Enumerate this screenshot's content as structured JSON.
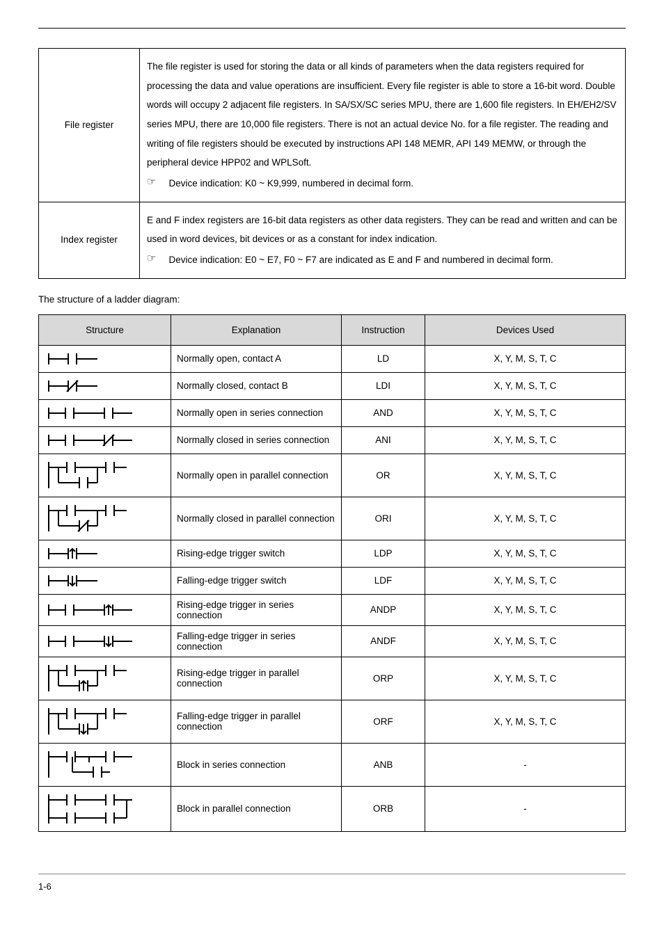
{
  "register_rows": [
    {
      "label": "File register",
      "paragraphs": [
        "The file register is used for storing the data or all kinds of parameters when the data registers required for processing the data and value operations are insufficient. Every file register is able to store a 16-bit word. Double words will occupy 2 adjacent file registers. In SA/SX/SC series MPU, there are 1,600 file registers. In EH/EH2/SV series MPU, there are 10,000 file registers. There is not an actual device No. for a file register. The reading and writing of file registers should be executed by instructions API 148 MEMR, API 149 MEMW, or through the peripheral device HPP02 and WPLSoft."
      ],
      "bullets": [
        "Device indication: K0 ~ K9,999, numbered in decimal form."
      ]
    },
    {
      "label": "Index register",
      "paragraphs": [
        "E and F index registers are 16-bit data registers as other data registers. They can be read and written and can be used in word devices, bit devices or as a constant for index indication."
      ],
      "bullets": [
        "Device indication: E0 ~ E7, F0 ~ F7 are indicated as E and F and numbered in decimal form."
      ]
    }
  ],
  "structure_caption": "The structure of a ladder diagram:",
  "structure_headers": {
    "structure": "Structure",
    "explanation": "Explanation",
    "instruction": "Instruction",
    "devices": "Devices Used"
  },
  "structure_rows": [
    {
      "icon": "no_a",
      "explanation": "Normally open, contact A",
      "instruction": "LD",
      "devices": "X, Y, M, S, T, C",
      "tall": false
    },
    {
      "icon": "nc_b",
      "explanation": "Normally closed, contact B",
      "instruction": "LDI",
      "devices": "X, Y, M, S, T, C",
      "tall": false
    },
    {
      "icon": "no_series",
      "explanation": "Normally open in series connection",
      "instruction": "AND",
      "devices": "X, Y, M, S, T, C",
      "tall": false
    },
    {
      "icon": "nc_series",
      "explanation": "Normally closed in series connection",
      "instruction": "ANI",
      "devices": "X, Y, M, S, T, C",
      "tall": false
    },
    {
      "icon": "no_parallel",
      "explanation": "Normally open in parallel connection",
      "instruction": "OR",
      "devices": "X, Y, M, S, T, C",
      "tall": true
    },
    {
      "icon": "nc_parallel",
      "explanation": "Normally closed in parallel connection",
      "instruction": "ORI",
      "devices": "X, Y, M, S, T, C",
      "tall": true
    },
    {
      "icon": "rise",
      "explanation": "Rising-edge trigger switch",
      "instruction": "LDP",
      "devices": "X, Y, M, S, T, C",
      "tall": false
    },
    {
      "icon": "fall",
      "explanation": "Falling-edge trigger switch",
      "instruction": "LDF",
      "devices": "X, Y, M, S, T, C",
      "tall": false
    },
    {
      "icon": "rise_series",
      "explanation": "Rising-edge trigger in series connection",
      "instruction": "ANDP",
      "devices": "X, Y, M, S, T, C",
      "tall": false
    },
    {
      "icon": "fall_series",
      "explanation": "Falling-edge trigger in series connection",
      "instruction": "ANDF",
      "devices": "X, Y, M, S, T, C",
      "tall": false
    },
    {
      "icon": "rise_parallel",
      "explanation": "Rising-edge trigger in parallel connection",
      "instruction": "ORP",
      "devices": "X, Y, M, S, T, C",
      "tall": true
    },
    {
      "icon": "fall_parallel",
      "explanation": "Falling-edge trigger in parallel connection",
      "instruction": "ORF",
      "devices": "X, Y, M, S, T, C",
      "tall": true
    },
    {
      "icon": "blk_series",
      "explanation": "Block in series connection",
      "instruction": "ANB",
      "devices": "-",
      "tall": true
    },
    {
      "icon": "blk_parallel",
      "explanation": "Block in parallel connection",
      "instruction": "ORB",
      "devices": "-",
      "tall": true
    }
  ],
  "page_number": "1-6"
}
